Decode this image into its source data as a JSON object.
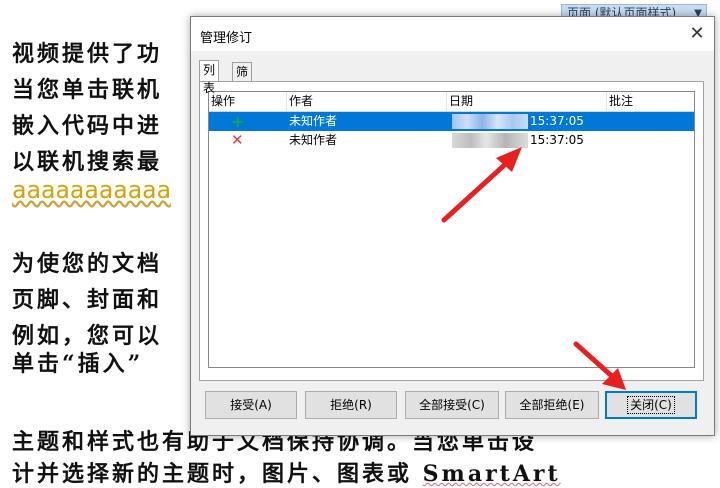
{
  "document": {
    "page_style": "页面 (默认页面样式)",
    "lines": [
      "视频提供了功",
      "当您单击联机",
      "嵌入代码中进",
      "以联机搜索最",
      "aaaaaaaaaaa",
      "为使您的文档",
      "页脚、封面和",
      "例如，您可以",
      "单击“插入”",
      "主题和样式也有助于文档保持协调。当您单击设",
      "计并选择新的主题时，图片、图表或 "
    ],
    "smartart": "SmartArt"
  },
  "dialog": {
    "title": "管理修订",
    "close_glyph": "✕",
    "tabs": [
      {
        "label": "列表",
        "active": true
      },
      {
        "label": "筛选",
        "active": false
      }
    ],
    "columns": [
      "操作",
      "作者",
      "日期",
      "批注"
    ],
    "rows": [
      {
        "action_icon": "insert-icon",
        "action_glyph": "+",
        "author": "未知作者",
        "time": "15:37:05",
        "comment": "",
        "selected": true
      },
      {
        "action_icon": "delete-icon",
        "action_glyph": "✕",
        "author": "未知作者",
        "time": "15:37:05",
        "comment": "",
        "selected": false
      }
    ],
    "buttons": {
      "accept": "接受(A)",
      "reject": "拒绝(R)",
      "accept_all": "全部接受(C)",
      "reject_all": "全部拒绝(E)",
      "close": "关闭(C)"
    }
  },
  "colors": {
    "selection": "#0078d7",
    "annotation_arrow": "#e8201f",
    "insert": "#1ea34a",
    "delete": "#e23b3b"
  }
}
